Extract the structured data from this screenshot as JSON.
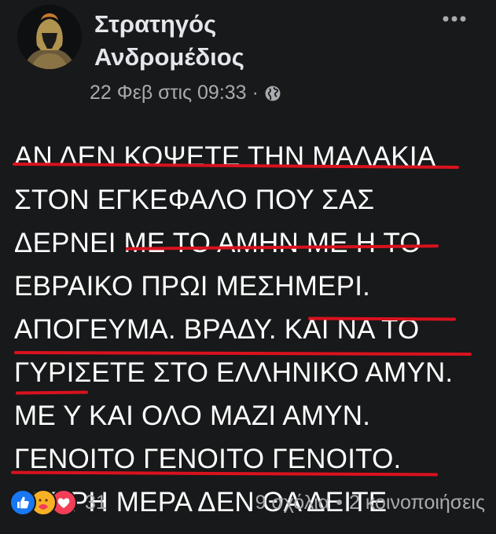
{
  "post": {
    "author": {
      "name_line1": "Στρατηγός",
      "name_line2": "Ανδρομέδιος"
    },
    "timestamp": "22 Φεβ στις 09:33",
    "separator": "·",
    "privacy_icon": "globe-icon",
    "menu_icon": "more-icon",
    "lines": [
      "ΑΝ ΔΕΝ ΚΟΨΕΤΕ ΤΗΝ ΜΑΛΑΚΙΑ",
      "ΣΤΟΝ ΕΓΚΕΦΑΛΟ ΠΟΥ ΣΑΣ",
      "ΔΕΡΝΕΙ ΜΕ ΤΟ ΑΜΗΝ ΜΕ Η ΤΟ",
      "ΕΒΡΑΙΚΟ ΠΡΩΙ ΜΕΣΗΜΕΡΙ.",
      "ΑΠΟΓΕΥΜΑ. ΒΡΑΔΥ. ΚΑΙ ΝΑ ΤΟ",
      "ΓΥΡΙΣΕΤΕ ΣΤΟ ΕΛΛΗΝΙΚΟ ΑΜΥΝ.",
      "ΜΕ Υ ΚΑΙ ΟΛΟ ΜΑΖΙ ΑΜΥΝ.",
      "ΓΕΝΟΙΤΟ ΓΕΝΟΙΤΟ ΓΕΝΟΙΤΟ.",
      "ΑΣΠΡΗ ΜΕΡΑ ΔΕΝ ΘΑ ΔΕΙΤΕ"
    ],
    "underline_color": "#d8121e",
    "reactions": {
      "icons": [
        "like-icon",
        "care-icon",
        "love-icon"
      ],
      "count": "31"
    },
    "comments": "9 σχόλια",
    "footer_separator": "•",
    "shares": "2 κοινοποιήσεις"
  }
}
